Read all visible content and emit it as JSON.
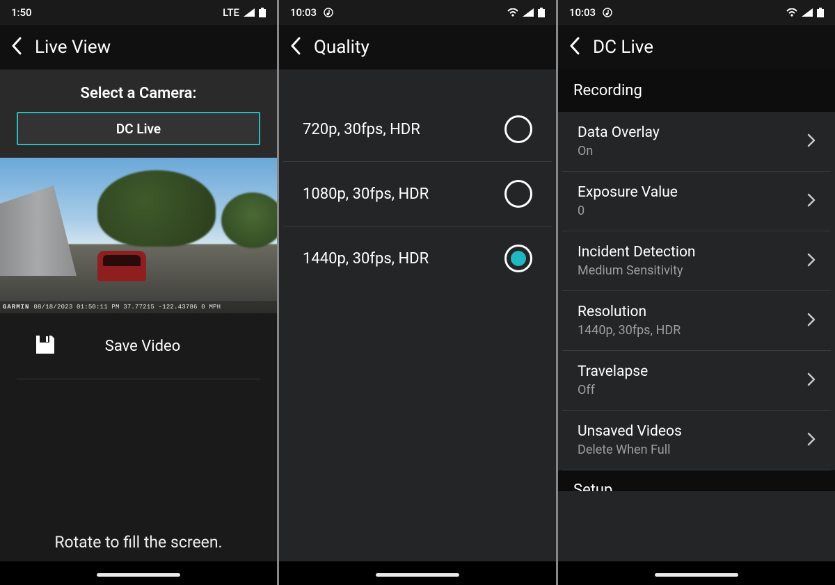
{
  "screen1": {
    "status": {
      "time": "1:50",
      "network": "LTE"
    },
    "header": {
      "title": "Live View"
    },
    "select_label": "Select a Camera:",
    "camera_button": "DC Live",
    "preview": {
      "brand": "GARMIN",
      "overlay": "08/18/2023 01:50:11 PM  37.77215 -122.43786  0 MPH"
    },
    "save_label": "Save Video",
    "rotate_hint": "Rotate to fill the screen."
  },
  "screen2": {
    "status": {
      "time": "10:03"
    },
    "header": {
      "title": "Quality"
    },
    "options": [
      {
        "label": "720p, 30fps, HDR",
        "selected": false
      },
      {
        "label": "1080p, 30fps, HDR",
        "selected": false
      },
      {
        "label": "1440p, 30fps, HDR",
        "selected": true
      }
    ]
  },
  "screen3": {
    "status": {
      "time": "10:03"
    },
    "header": {
      "title": "DC Live"
    },
    "section1_title": "Recording",
    "settings": [
      {
        "name": "Data Overlay",
        "value": "On"
      },
      {
        "name": "Exposure Value",
        "value": "0"
      },
      {
        "name": "Incident Detection",
        "value": "Medium Sensitivity"
      },
      {
        "name": "Resolution",
        "value": "1440p, 30fps, HDR"
      },
      {
        "name": "Travelapse",
        "value": "Off"
      },
      {
        "name": "Unsaved Videos",
        "value": "Delete When Full"
      }
    ],
    "section2_title": "Setup"
  },
  "colors": {
    "accent": "#20b7c3"
  }
}
